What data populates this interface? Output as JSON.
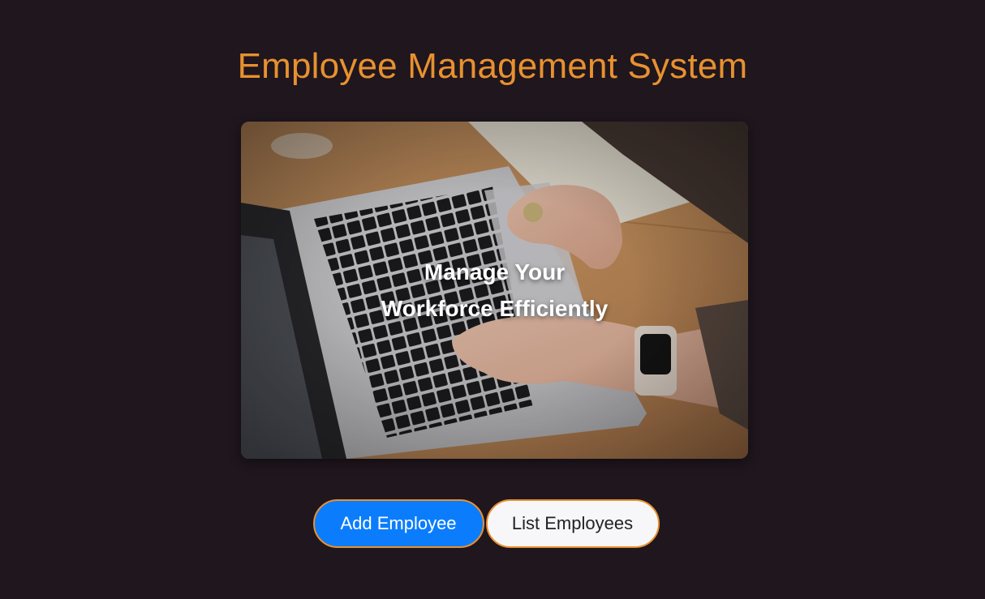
{
  "header": {
    "title": "Employee Management System"
  },
  "hero": {
    "image_alt": "hands-typing-on-laptop-photo",
    "tagline_line1": "Manage Your",
    "tagline_line2": "Workforce Efficiently"
  },
  "actions": {
    "add_label": "Add Employee",
    "list_label": "List Employees"
  },
  "colors": {
    "background": "#1f161e",
    "accent": "#e8912f",
    "primary": "#0b7dfc"
  }
}
